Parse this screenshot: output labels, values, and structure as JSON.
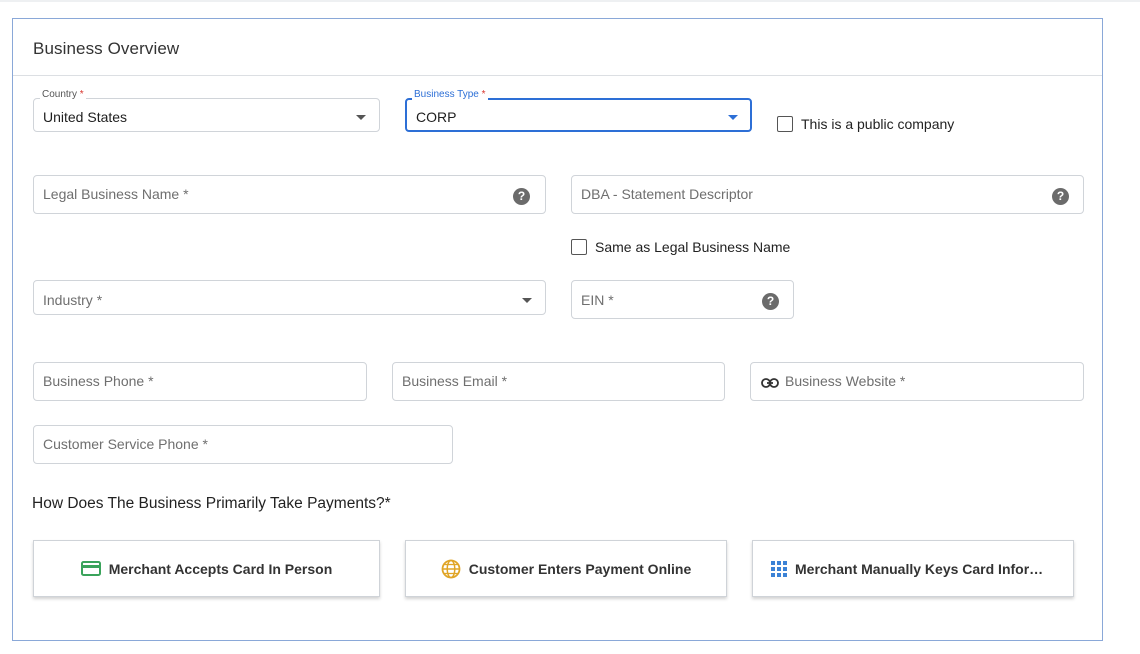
{
  "section": {
    "title": "Business Overview"
  },
  "country": {
    "label": "Country",
    "required_mark": "*",
    "value": "United States"
  },
  "business_type": {
    "label": "Business Type",
    "required_mark": "*",
    "value": "CORP"
  },
  "public_company": {
    "label": "This is a public company",
    "checked": false
  },
  "legal_business_name": {
    "placeholder": "Legal Business Name *"
  },
  "dba": {
    "placeholder": "DBA - Statement Descriptor"
  },
  "same_as_legal": {
    "label": "Same as Legal Business Name",
    "checked": false
  },
  "industry": {
    "placeholder": "Industry *"
  },
  "ein": {
    "placeholder": "EIN *"
  },
  "business_phone": {
    "placeholder": "Business Phone *"
  },
  "business_email": {
    "placeholder": "Business Email *"
  },
  "business_website": {
    "placeholder": "Business Website *"
  },
  "customer_service_phone": {
    "placeholder": "Customer Service Phone *"
  },
  "payments": {
    "question": "How Does The Business Primarily Take Payments?*",
    "options": [
      {
        "label": "Merchant Accepts Card In Person",
        "icon": "credit-card-icon",
        "color": "#3aa35b"
      },
      {
        "label": "Customer Enters Payment Online",
        "icon": "globe-icon",
        "color": "#e0a526"
      },
      {
        "label": "Merchant Manually Keys Card Informa...",
        "icon": "keypad-grid-icon",
        "color": "#3b82d6"
      }
    ]
  },
  "colors": {
    "focus_blue": "#2d6fd6",
    "required_red": "#d8342c",
    "card_border": "#8aa8d8"
  }
}
